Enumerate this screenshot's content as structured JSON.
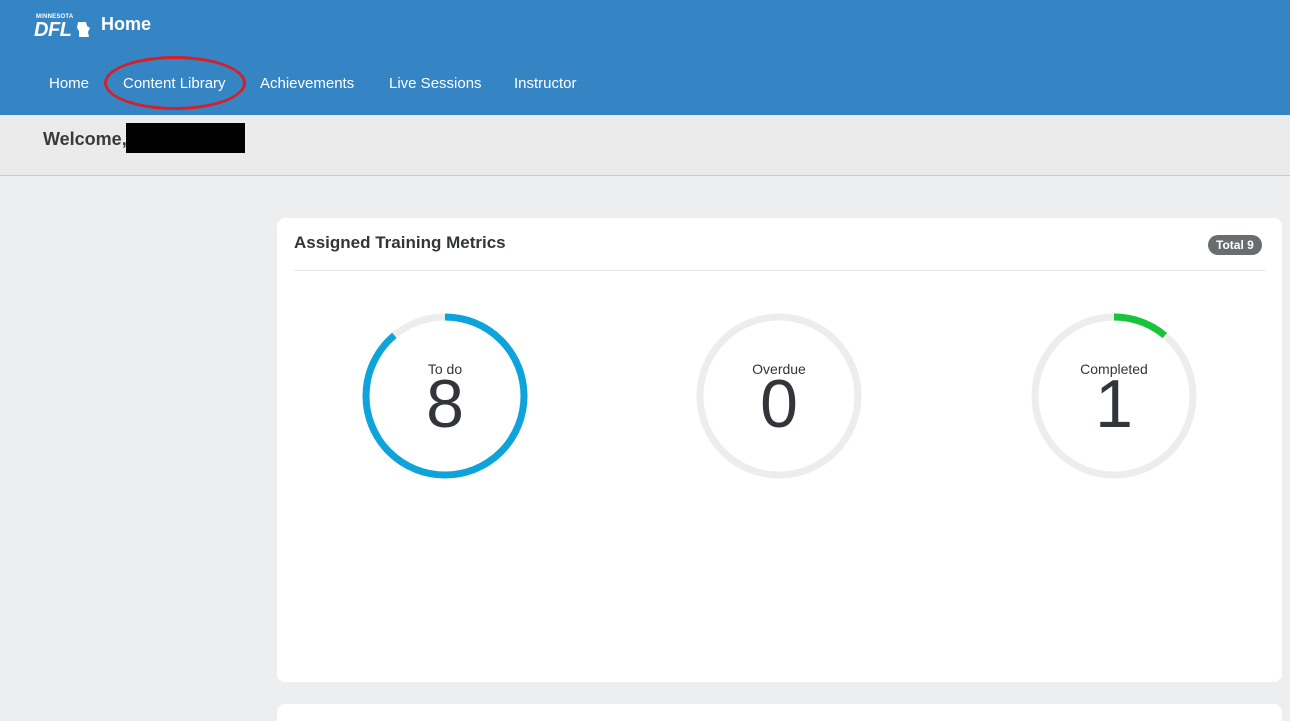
{
  "header": {
    "logo_small": "MINNESOTA",
    "logo_big": "DFL",
    "title": "Home",
    "bg_color": "#3584c4"
  },
  "nav": {
    "items": [
      {
        "label": "Home"
      },
      {
        "label": "Content Library"
      },
      {
        "label": "Achievements"
      },
      {
        "label": "Live Sessions"
      },
      {
        "label": "Instructor"
      }
    ]
  },
  "welcome": {
    "text": "Welcome,"
  },
  "metrics_card": {
    "title": "Assigned Training Metrics",
    "badge": "Total 9",
    "metrics": [
      {
        "label": "To do",
        "value": "8",
        "count": 8,
        "total": 9,
        "color": "#0ea4db"
      },
      {
        "label": "Overdue",
        "value": "0",
        "count": 0,
        "total": 9,
        "color": "#e8533b"
      },
      {
        "label": "Completed",
        "value": "1",
        "count": 1,
        "total": 9,
        "color": "#19c43c"
      }
    ]
  },
  "colors": {
    "ring_track": "#ededed",
    "highlight": "#d42028"
  }
}
